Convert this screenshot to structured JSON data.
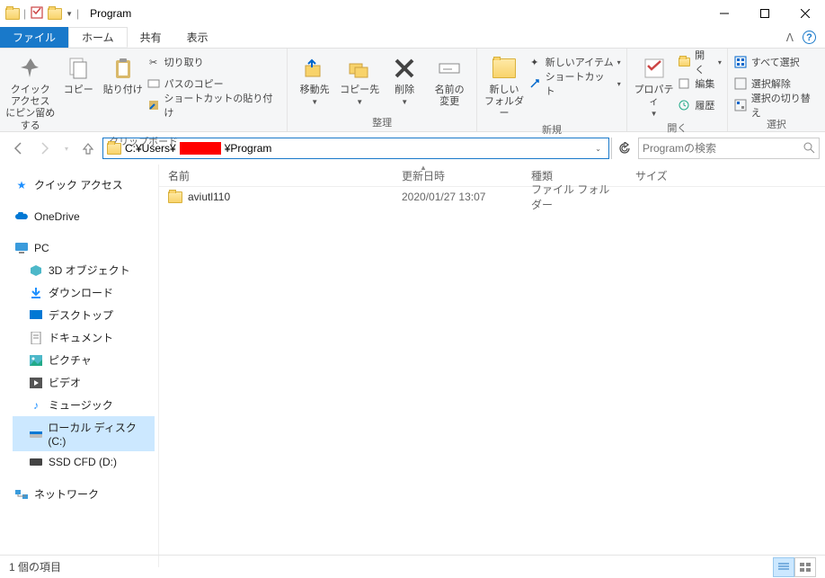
{
  "window": {
    "title": "Program"
  },
  "tabs": {
    "file": "ファイル",
    "home": "ホーム",
    "share": "共有",
    "view": "表示"
  },
  "ribbon": {
    "quickaccess": {
      "pin": "クイック アクセス\nにピン留めする",
      "copy": "コピー",
      "paste": "貼り付け",
      "cut": "切り取り",
      "copypath": "パスのコピー",
      "pasteshortcut": "ショートカットの貼り付け",
      "group": "クリップボード"
    },
    "organize": {
      "moveto": "移動先",
      "copyto": "コピー先",
      "delete": "削除",
      "rename": "名前の\n変更",
      "group": "整理"
    },
    "new": {
      "folder": "新しい\nフォルダー",
      "item": "新しいアイテム",
      "shortcut": "ショートカット",
      "group": "新規"
    },
    "open": {
      "properties": "プロパティ",
      "open": "開く",
      "edit": "編集",
      "history": "履歴",
      "group": "開く"
    },
    "select": {
      "all": "すべて選択",
      "none": "選択解除",
      "invert": "選択の切り替え",
      "group": "選択"
    }
  },
  "address": {
    "prefix": "C:¥Users¥",
    "suffix": "¥Program"
  },
  "search": {
    "placeholder": "Programの検索"
  },
  "sidebar": {
    "quickaccess": "クイック アクセス",
    "onedrive": "OneDrive",
    "pc": "PC",
    "items": {
      "3dobjects": "3D オブジェクト",
      "downloads": "ダウンロード",
      "desktop": "デスクトップ",
      "documents": "ドキュメント",
      "pictures": "ピクチャ",
      "videos": "ビデオ",
      "music": "ミュージック",
      "cdrive": "ローカル ディスク (C:)",
      "ddrive": "SSD CFD (D:)"
    },
    "network": "ネットワーク"
  },
  "columns": {
    "name": "名前",
    "date": "更新日時",
    "type": "種類",
    "size": "サイズ"
  },
  "files": [
    {
      "name": "aviutl110",
      "date": "2020/01/27 13:07",
      "type": "ファイル フォルダー",
      "size": ""
    }
  ],
  "status": {
    "count": "1 個の項目"
  }
}
